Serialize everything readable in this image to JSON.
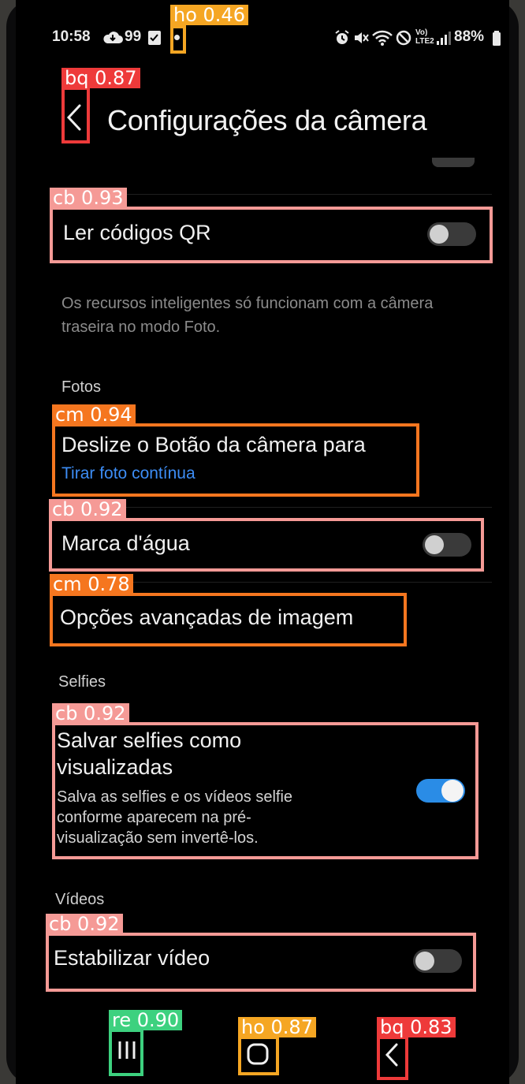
{
  "status": {
    "time": "10:58",
    "left_icons_text": "99",
    "battery": "88%"
  },
  "header": {
    "title": "Configurações da câmera"
  },
  "list": {
    "qr_label": "Ler códigos QR",
    "note": "Os recursos inteligentes só funcionam com a câmera traseira no modo Foto.",
    "photos_section": "Fotos",
    "swipe_label": "Deslize o Botão da câmera para",
    "swipe_value": "Tirar foto contínua",
    "watermark_label": "Marca d'água",
    "advanced_label": "Opções avançadas de imagem",
    "selfies_section": "Selfies",
    "save_selfies_label": "Salvar selfies como visualizadas",
    "save_selfies_desc": "Salva as selfies e os vídeos selfie conforme aparecem na pré-visualização sem invertê-los.",
    "videos_section": "Vídeos",
    "stabilize_label": "Estabilizar vídeo"
  },
  "toggles": {
    "qr": false,
    "watermark": false,
    "save_selfies": true,
    "stabilize": false
  },
  "annotations": [
    {
      "tag": "ho 0.46",
      "color": "#f5a623"
    },
    {
      "tag": "bq 0.87",
      "color": "#ee3a3a"
    },
    {
      "tag": "cb 0.93",
      "color": "#f59a96"
    },
    {
      "tag": "cm 0.94",
      "color": "#f5761f"
    },
    {
      "tag": "cb 0.92",
      "color": "#f59a96"
    },
    {
      "tag": "cm 0.78",
      "color": "#f5761f"
    },
    {
      "tag": "cb 0.92",
      "color": "#f59a96"
    },
    {
      "tag": "cb 0.92",
      "color": "#f59a96"
    },
    {
      "tag": "re 0.90",
      "color": "#3dd17f"
    },
    {
      "tag": "ho 0.87",
      "color": "#f5a623"
    },
    {
      "tag": "bq 0.83",
      "color": "#ee3a3a"
    }
  ],
  "icons": [
    "cloud-icon",
    "image-icon",
    "alarm-icon",
    "mute-icon",
    "wifi-icon",
    "dnd-icon",
    "volte-icon",
    "signal-icon",
    "battery-icon",
    "back-icon",
    "recents-icon",
    "home-icon",
    "nav-back-icon"
  ]
}
